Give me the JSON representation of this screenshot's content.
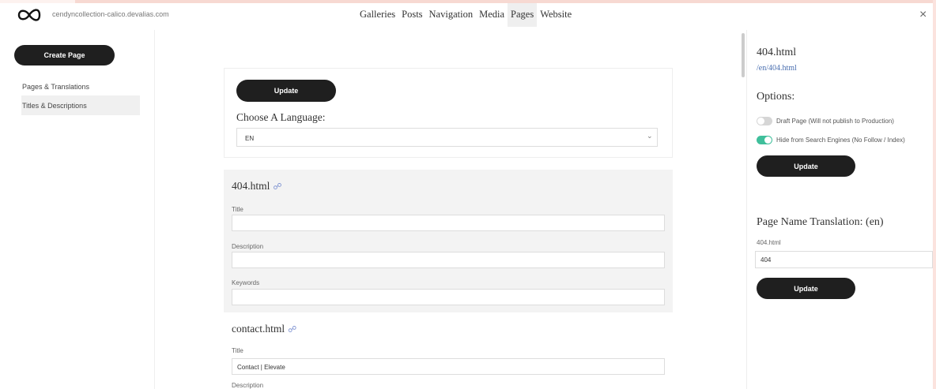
{
  "header": {
    "site_url": "cendyncollection-calico.devalias.com",
    "nav": [
      "Galleries",
      "Posts",
      "Navigation",
      "Media",
      "Pages",
      "Website"
    ],
    "active_nav": "Pages",
    "close_symbol": "×"
  },
  "sidebar": {
    "create_label": "Create Page",
    "items": [
      {
        "label": "Pages & Translations"
      },
      {
        "label": "Titles & Descriptions"
      }
    ]
  },
  "main": {
    "update_label": "Update",
    "choose_label": "Choose A Language:",
    "language_value": "EN",
    "pages": [
      {
        "name": "404.html",
        "fields": [
          {
            "label": "Title",
            "value": ""
          },
          {
            "label": "Description",
            "value": ""
          },
          {
            "label": "Keywords",
            "value": ""
          }
        ]
      },
      {
        "name": "contact.html",
        "fields": [
          {
            "label": "Title",
            "value": "Contact | Elevate"
          },
          {
            "label": "Description",
            "value": ""
          }
        ]
      }
    ]
  },
  "right_panel": {
    "page_name": "404.html",
    "page_path": "/en/404.html",
    "options_heading": "Options:",
    "toggles": [
      {
        "label": "Draft Page (Will not publish to Production)",
        "on": false
      },
      {
        "label": "Hide from Search Engines (No Follow / Index)",
        "on": true
      }
    ],
    "update_label": "Update",
    "translation_heading": "Page Name Translation: (en)",
    "translation_label": "404.html",
    "translation_value": "404",
    "update_label_2": "Update"
  },
  "colors": {
    "accent_toggle": "#3fbf9b",
    "dark_button": "#1f1f1f",
    "link": "#4a6fb0"
  },
  "icons": {
    "logo": "infinity-icon",
    "external_link": "external-link-icon",
    "dropdown": "chevron-down-icon",
    "close": "close-icon"
  }
}
